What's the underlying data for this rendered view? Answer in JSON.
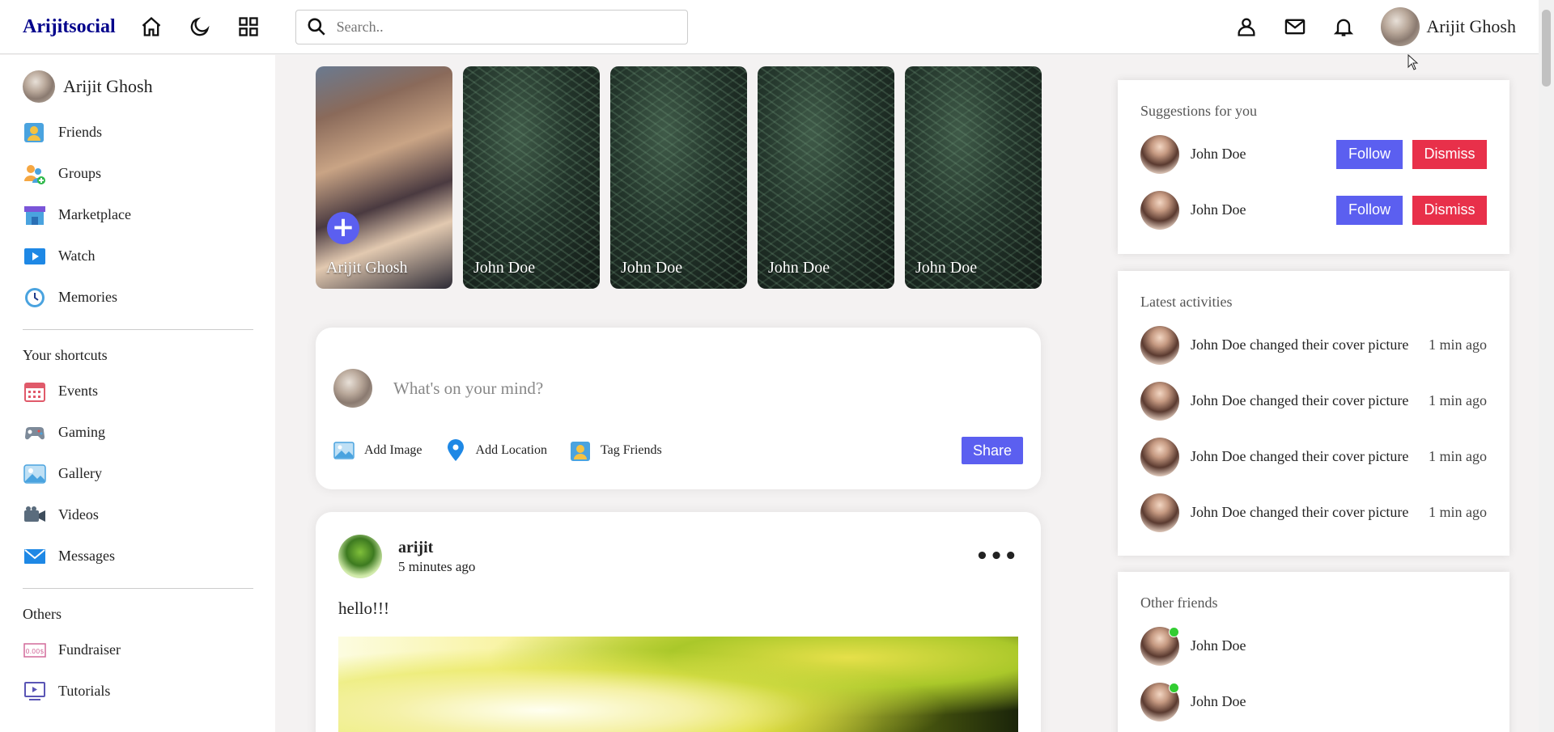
{
  "navbar": {
    "logo": "Arijitsocial",
    "search_placeholder": "Search..",
    "user_name": "Arijit Ghosh"
  },
  "sidebar": {
    "user_name": "Arijit Ghosh",
    "main_items": [
      {
        "label": "Friends",
        "icon": "friends-icon"
      },
      {
        "label": "Groups",
        "icon": "groups-icon"
      },
      {
        "label": "Marketplace",
        "icon": "marketplace-icon"
      },
      {
        "label": "Watch",
        "icon": "watch-icon"
      },
      {
        "label": "Memories",
        "icon": "clock-icon"
      }
    ],
    "shortcuts_heading": "Your shortcuts",
    "shortcut_items": [
      {
        "label": "Events",
        "icon": "calendar-icon"
      },
      {
        "label": "Gaming",
        "icon": "gamepad-icon"
      },
      {
        "label": "Gallery",
        "icon": "gallery-icon"
      },
      {
        "label": "Videos",
        "icon": "video-camera-icon"
      },
      {
        "label": "Messages",
        "icon": "mail-icon"
      }
    ],
    "others_heading": "Others",
    "other_items": [
      {
        "label": "Fundraiser",
        "icon": "fundraiser-icon"
      },
      {
        "label": "Tutorials",
        "icon": "tutorials-icon"
      }
    ]
  },
  "stories": [
    {
      "name": "Arijit Ghosh",
      "own": true
    },
    {
      "name": "John Doe"
    },
    {
      "name": "John Doe"
    },
    {
      "name": "John Doe"
    },
    {
      "name": "John Doe"
    }
  ],
  "share_box": {
    "placeholder": "What's on your mind?",
    "add_image": "Add Image",
    "add_location": "Add Location",
    "tag_friends": "Tag Friends",
    "share_label": "Share"
  },
  "post": {
    "author": "arijit",
    "time": "5 minutes ago",
    "text": "hello!!!"
  },
  "suggestions": {
    "title": "Suggestions for you",
    "follow_label": "Follow",
    "dismiss_label": "Dismiss",
    "people": [
      {
        "name": "John Doe"
      },
      {
        "name": "John Doe"
      }
    ]
  },
  "activities": {
    "title": "Latest activities",
    "items": [
      {
        "name": "John Doe",
        "text": "changed their cover picture",
        "time": "1 min ago"
      },
      {
        "name": "John Doe",
        "text": "changed their cover picture",
        "time": "1 min ago"
      },
      {
        "name": "John Doe",
        "text": "changed their cover picture",
        "time": "1 min ago"
      },
      {
        "name": "John Doe",
        "text": "changed their cover picture",
        "time": "1 min ago"
      }
    ]
  },
  "other_friends": {
    "title": "Other friends",
    "people": [
      {
        "name": "John Doe",
        "online": true
      },
      {
        "name": "John Doe",
        "online": true
      }
    ]
  },
  "colors": {
    "accent": "#5b5ff0",
    "danger": "#e8304a",
    "logo": "#00008b",
    "online": "#32cd32"
  }
}
